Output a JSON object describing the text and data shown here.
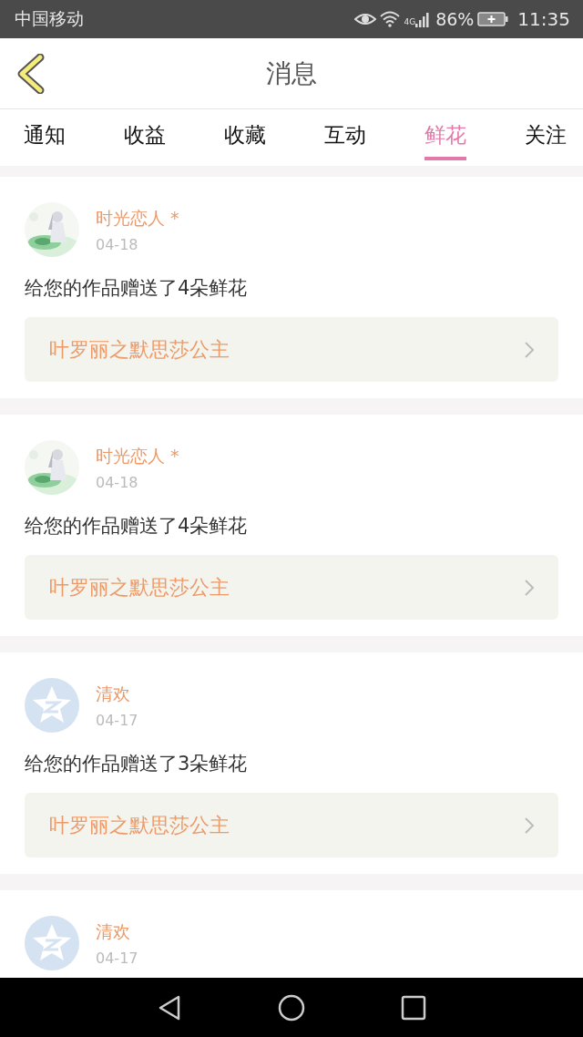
{
  "status_bar": {
    "carrier": "中国移动",
    "network": "4G",
    "battery": "86%",
    "time": "11:35"
  },
  "header": {
    "title": "消息"
  },
  "tabs": [
    {
      "label": "通知",
      "selected": false
    },
    {
      "label": "收益",
      "selected": false
    },
    {
      "label": "收藏",
      "selected": false
    },
    {
      "label": "互动",
      "selected": false
    },
    {
      "label": "鲜花",
      "selected": true
    },
    {
      "label": "关注",
      "selected": false
    }
  ],
  "messages": [
    {
      "name": "时光恋人 *",
      "date": "04-18",
      "text": "给您的作品赠送了4朵鲜花",
      "work": "叶罗丽之默思莎公主"
    },
    {
      "name": "时光恋人 *",
      "date": "04-18",
      "text": "给您的作品赠送了4朵鲜花",
      "work": "叶罗丽之默思莎公主"
    },
    {
      "avatar": {
        "kind": "default"
      },
      "name": "清欢",
      "date": "04-17",
      "text": "给您的作品赠送了3朵鲜花",
      "work": "叶罗丽之默思莎公主"
    },
    {
      "avatar": {
        "kind": "default"
      },
      "name": "清欢",
      "date": "04-17"
    }
  ]
}
